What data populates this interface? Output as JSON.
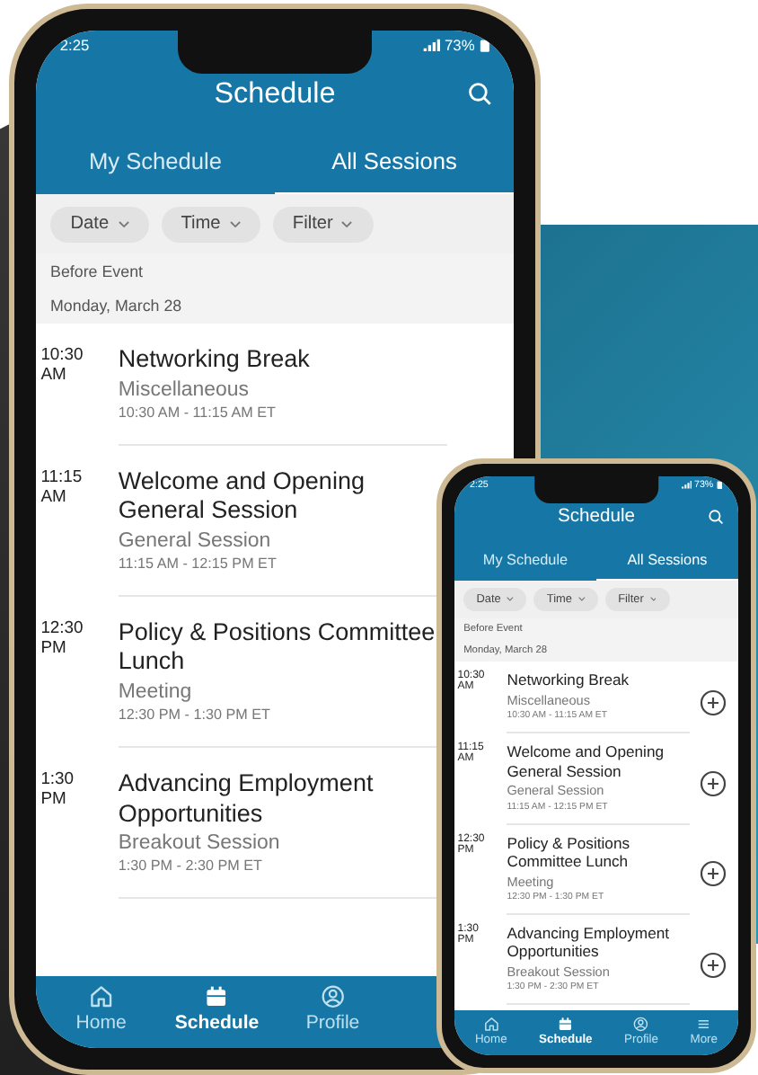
{
  "phones": [
    {
      "kind": "large",
      "status": {
        "time": "2:25",
        "battery": "73%"
      },
      "title": "Schedule",
      "tabs": [
        {
          "label": "My Schedule",
          "selected": false
        },
        {
          "label": "All Sessions",
          "selected": true
        }
      ],
      "chips": [
        "Date",
        "Time",
        "Filter"
      ],
      "section": "Before Event",
      "date": "Monday, March 28",
      "sessions": [
        {
          "time": "10:30 AM",
          "title": "Networking Break",
          "category": "Miscellaneous",
          "range": "10:30 AM - 11:15 AM ET"
        },
        {
          "time": "11:15 AM",
          "title": "Welcome and Opening General Session",
          "category": "General Session",
          "range": "11:15 AM - 12:15 PM ET"
        },
        {
          "time": "12:30 PM",
          "title": "Policy & Positions Committee Lunch",
          "category": "Meeting",
          "range": "12:30 PM - 1:30 PM ET"
        },
        {
          "time": "1:30 PM",
          "title": "Advancing Employment Opportunities",
          "category": "Breakout Session",
          "range": "1:30 PM - 2:30 PM ET"
        }
      ],
      "nav": [
        {
          "kind": "home",
          "label": "Home",
          "selected": false
        },
        {
          "kind": "calendar",
          "label": "Schedule",
          "selected": true
        },
        {
          "kind": "profile",
          "label": "Profile",
          "selected": false
        }
      ]
    },
    {
      "kind": "small",
      "status": {
        "time": "2:25",
        "battery": "73%"
      },
      "title": "Schedule",
      "tabs": [
        {
          "label": "My Schedule",
          "selected": false
        },
        {
          "label": "All Sessions",
          "selected": true
        }
      ],
      "chips": [
        "Date",
        "Time",
        "Filter"
      ],
      "section": "Before Event",
      "date": "Monday, March 28",
      "sessions": [
        {
          "time": "10:30 AM",
          "title": "Networking Break",
          "category": "Miscellaneous",
          "range": "10:30 AM - 11:15 AM ET"
        },
        {
          "time": "11:15 AM",
          "title": "Welcome and Opening General Session",
          "category": "General Session",
          "range": "11:15 AM - 12:15 PM ET"
        },
        {
          "time": "12:30 PM",
          "title": "Policy & Positions Committee Lunch",
          "category": "Meeting",
          "range": "12:30 PM - 1:30 PM ET"
        },
        {
          "time": "1:30 PM",
          "title": "Advancing Employment Opportunities",
          "category": "Breakout Session",
          "range": "1:30 PM - 2:30 PM ET"
        }
      ],
      "nav": [
        {
          "kind": "home",
          "label": "Home",
          "selected": false
        },
        {
          "kind": "calendar",
          "label": "Schedule",
          "selected": true
        },
        {
          "kind": "profile",
          "label": "Profile",
          "selected": false
        },
        {
          "kind": "menu",
          "label": "More",
          "selected": false
        }
      ]
    }
  ]
}
